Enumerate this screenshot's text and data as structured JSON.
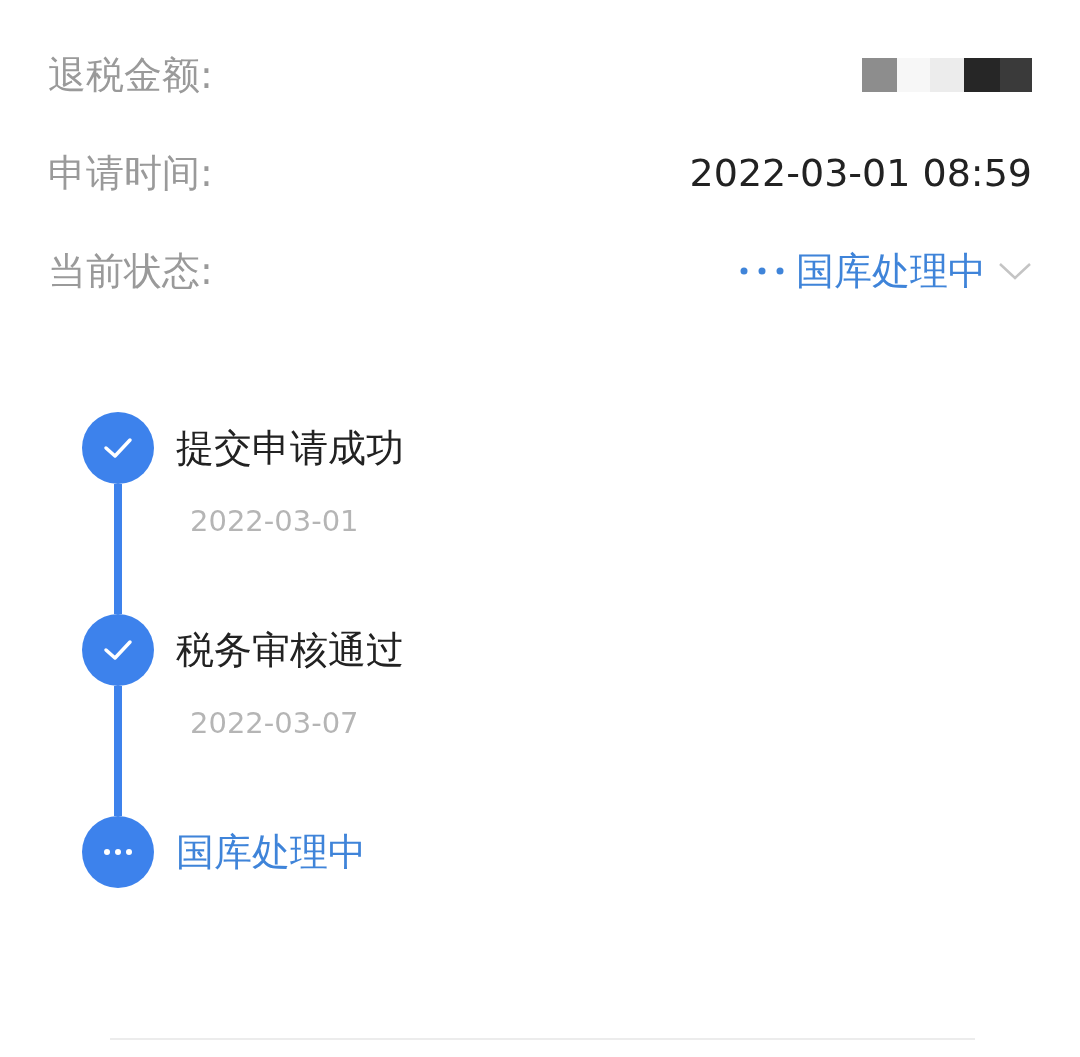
{
  "fields": [
    {
      "label": "退税金额:",
      "kind": "redacted"
    },
    {
      "label": "申请时间:",
      "kind": "text",
      "value": "2022-03-01 08:59"
    },
    {
      "label": "当前状态:",
      "kind": "status",
      "value": "国库处理中"
    }
  ],
  "steps": [
    {
      "title": "提交申请成功",
      "date": "2022-03-01",
      "done": true
    },
    {
      "title": "税务审核通过",
      "date": "2022-03-07",
      "done": true
    },
    {
      "title": "国库处理中",
      "done": false
    }
  ]
}
